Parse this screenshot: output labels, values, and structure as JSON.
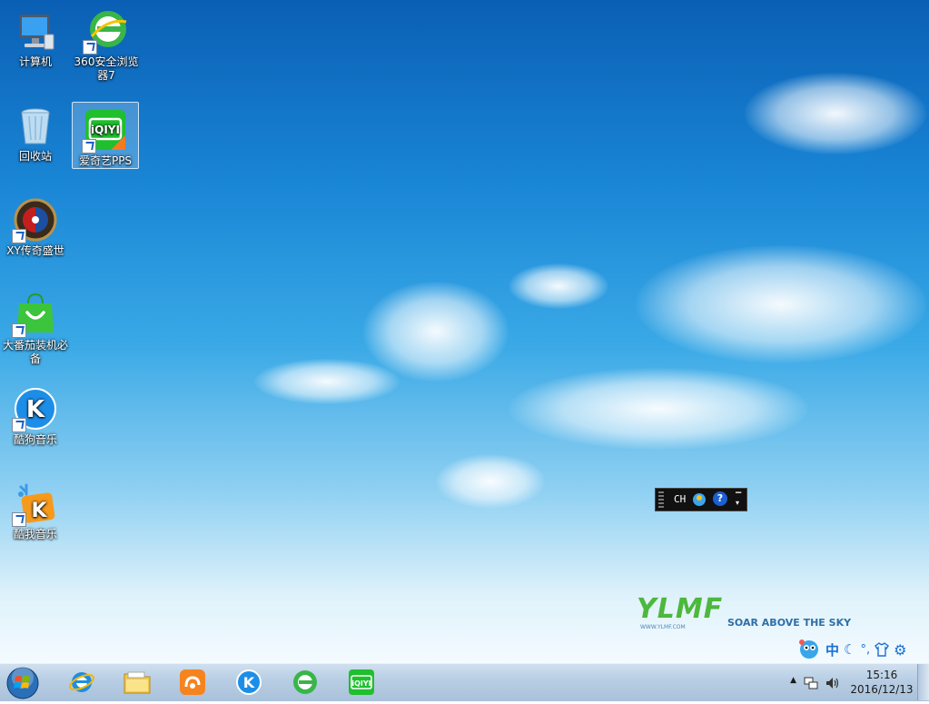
{
  "desktop": {
    "icons": [
      {
        "label": "计算机"
      },
      {
        "label": "360安全浏览器7"
      },
      {
        "label": "回收站"
      },
      {
        "label": "爱奇艺PPS"
      },
      {
        "label": "XY传奇盛世"
      },
      {
        "label": "大番茄装机必备"
      },
      {
        "label": "酷狗音乐"
      },
      {
        "label": "酷我音乐"
      }
    ],
    "watermark": {
      "logo": "YLMF",
      "tagline": "SOAR ABOVE THE SKY",
      "url": "WWW.YLMF.COM"
    }
  },
  "language_bar": {
    "lang": "CH",
    "help": "?"
  },
  "ime_toolbar": {
    "mode": "中",
    "punct": "°,",
    "icons": [
      "mascot-icon",
      "moon-icon",
      "shirt-icon",
      "gear-icon"
    ]
  },
  "taskbar": {
    "start_icon": "windows-orb-icon",
    "pinned": [
      "internet-explorer-icon",
      "file-explorer-icon",
      "uc-browser-icon",
      "kugou-icon",
      "360-browser-icon",
      "iqiyi-icon"
    ]
  },
  "tray": {
    "time": "15:16",
    "date": "2016/12/13"
  },
  "colors": {
    "sky_top": "#0a5fb4",
    "taskbar": "#b7cde3",
    "iqiyi_green": "#1fbf2e",
    "ylmf_green": "#4cb83c"
  }
}
